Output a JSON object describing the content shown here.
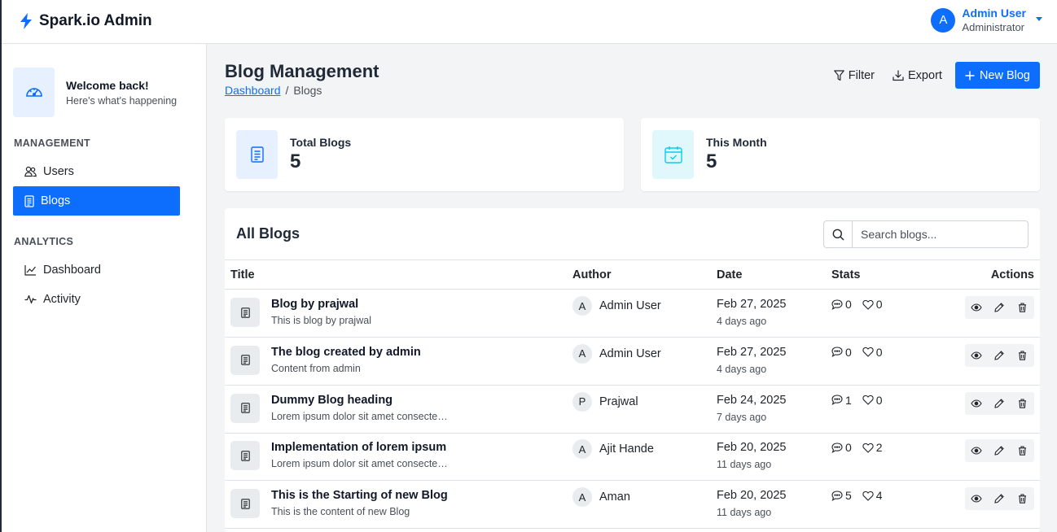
{
  "app": {
    "brand": "Spark.io Admin"
  },
  "user": {
    "initial": "A",
    "name": "Admin User",
    "role": "Administrator"
  },
  "sidebar": {
    "welcome_title": "Welcome back!",
    "welcome_subtitle": "Here's what's happening",
    "sections": [
      {
        "heading": "MANAGEMENT",
        "items": [
          {
            "label": "Users",
            "icon": "users-icon",
            "active": false
          },
          {
            "label": "Blogs",
            "icon": "document-icon",
            "active": true
          }
        ]
      },
      {
        "heading": "ANALYTICS",
        "items": [
          {
            "label": "Dashboard",
            "icon": "chart-line-icon",
            "active": false
          },
          {
            "label": "Activity",
            "icon": "activity-icon",
            "active": false
          }
        ]
      }
    ]
  },
  "header": {
    "title": "Blog Management",
    "breadcrumb": [
      "Dashboard",
      "Blogs"
    ],
    "breadcrumb_separator": "/",
    "filter_label": "Filter",
    "export_label": "Export",
    "new_label": "New Blog"
  },
  "stats": [
    {
      "label": "Total Blogs",
      "value": "5",
      "icon": "document-icon"
    },
    {
      "label": "This Month",
      "value": "5",
      "icon": "calendar-check-icon"
    }
  ],
  "blogs": {
    "title": "All Blogs",
    "search_placeholder": "Search blogs...",
    "columns": [
      "Title",
      "Author",
      "Date",
      "Stats",
      "Actions"
    ],
    "rows": [
      {
        "title": "Blog by prajwal",
        "excerpt": "This is blog by prajwal",
        "author_initial": "A",
        "author": "Admin User",
        "date": "Feb 27, 2025",
        "ago": "4 days ago",
        "comments": "0",
        "likes": "0"
      },
      {
        "title": "The blog created by admin",
        "excerpt": "Content from admin",
        "author_initial": "A",
        "author": "Admin User",
        "date": "Feb 27, 2025",
        "ago": "4 days ago",
        "comments": "0",
        "likes": "0"
      },
      {
        "title": "Dummy Blog heading",
        "excerpt": "Lorem ipsum dolor sit amet consecte…",
        "author_initial": "P",
        "author": "Prajwal",
        "date": "Feb 24, 2025",
        "ago": "7 days ago",
        "comments": "1",
        "likes": "0"
      },
      {
        "title": "Implementation of lorem ipsum",
        "excerpt": "Lorem ipsum dolor sit amet consecte…",
        "author_initial": "A",
        "author": "Ajit Hande",
        "date": "Feb 20, 2025",
        "ago": "11 days ago",
        "comments": "0",
        "likes": "2"
      },
      {
        "title": "This is the Starting of new Blog",
        "excerpt": "This is the content of new Blog",
        "author_initial": "A",
        "author": "Aman",
        "date": "Feb 20, 2025",
        "ago": "11 days ago",
        "comments": "5",
        "likes": "4"
      }
    ]
  },
  "colors": {
    "primary": "#0d6efd",
    "stat_blue_bg": "#e7f0fe",
    "stat_cyan_bg": "#e0f8fc",
    "stat_cyan": "#0dcaf0"
  }
}
